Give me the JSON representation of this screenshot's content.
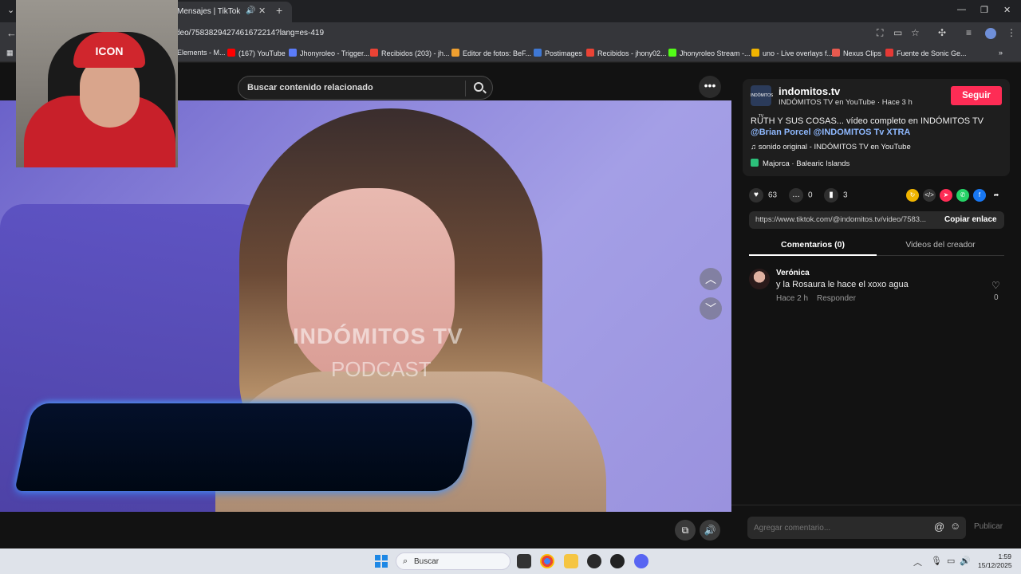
{
  "browser": {
    "tab_title": "Mensajes | TikTok",
    "url": "deo/7583829427461672214?lang=es-419",
    "bookmarks": [
      {
        "label": "Elements - M...",
        "color": "#9aa0a6"
      },
      {
        "label": "(167) YouTube",
        "color": "#ff0000"
      },
      {
        "label": "Jhonyroleo - Trigger...",
        "color": "#5b7cfa"
      },
      {
        "label": "Recibidos (203) - jh...",
        "color": "#ea4335"
      },
      {
        "label": "Editor de fotos: BeF...",
        "color": "#f0a030"
      },
      {
        "label": "Postimages",
        "color": "#3f78d4"
      },
      {
        "label": "Recibidos - jhony02...",
        "color": "#ea4335"
      },
      {
        "label": "Jhonyroleo Stream -...",
        "color": "#53fc18"
      },
      {
        "label": "uno - Live overlays f...",
        "color": "#f0b400"
      },
      {
        "label": "Nexus Clips",
        "color": "#e85a4f"
      },
      {
        "label": "Fuente de Sonic Ge...",
        "color": "#e53935"
      }
    ]
  },
  "tiktok": {
    "search_placeholder": "Buscar contenido relacionado",
    "video": {
      "watermark_line1": "INDÓMITOS TV",
      "watermark_line2": "PODCAST"
    },
    "channel": {
      "name": "indomitos.tv",
      "avatar_text": "INDÓMITOS TV",
      "subtitle": "INDÓMITOS TV en YouTube · Hace 3 h",
      "follow_label": "Seguir"
    },
    "description": "RUTH Y SUS COSAS... vídeo completo en INDÓMITOS TV",
    "description_tags": "@Brian Porcel @INDOMITOS Tv XTRA",
    "music": "sonido original - INDÓMITOS TV en YouTube",
    "location": "Majorca · Balearic Islands",
    "stats": {
      "likes": "63",
      "comments": "0",
      "saves": "3"
    },
    "link": "https://www.tiktok.com/@indomitos.tv/video/7583...",
    "copy_label": "Copiar enlace",
    "tabs": {
      "comments": "Comentarios (0)",
      "creator": "Videos del creador"
    },
    "comment": {
      "user": "Verónica",
      "text": "y la Rosaura le hace el xoxo agua",
      "time": "Hace 2 h",
      "reply": "Responder",
      "likes": "0"
    },
    "compose": {
      "placeholder": "Agregar comentario...",
      "publish": "Publicar"
    }
  },
  "webcam": {
    "cap_text": "ICON"
  },
  "taskbar": {
    "search_label": "Buscar",
    "time": "1:59",
    "date": "15/12/2025"
  }
}
